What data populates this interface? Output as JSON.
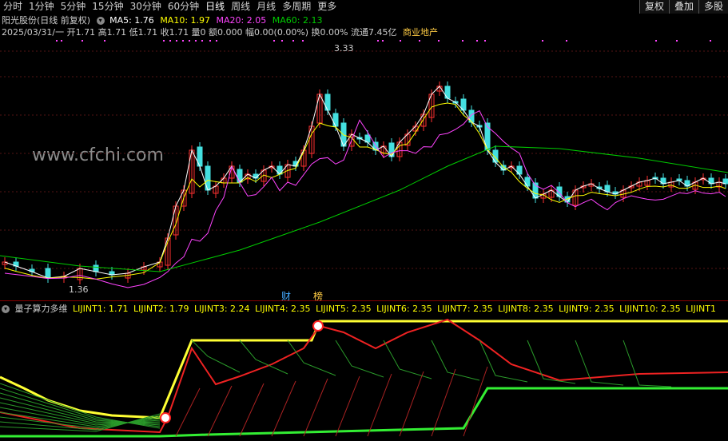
{
  "toolbar": {
    "tabs": [
      "分时",
      "1分钟",
      "5分钟",
      "15分钟",
      "30分钟",
      "60分钟",
      "日线",
      "周线",
      "月线",
      "多周期",
      "更多"
    ],
    "active": "日线",
    "right": [
      "复权",
      "叠加",
      "多股"
    ]
  },
  "header": {
    "title": "阳光股份(日线 前复权)",
    "ma5": "MA5: 1.76",
    "ma10": "MA10: 1.97",
    "ma20": "MA20: 2.05",
    "ma60": "MA60: 2.13",
    "info": "2025/03/31/一 开1.71 高1.71 低1.71 收1.71 量0 额0.000 幅0.00(0.00%) 换0.00% 流通7.45亿",
    "sector": "商业地产"
  },
  "price_labels": {
    "high": "3.33",
    "low": "1.36"
  },
  "tags": {
    "cai": "财",
    "bang": "榜"
  },
  "watermark": "www.cfchi.com",
  "indicator": {
    "title": "量子算力多维",
    "values": [
      "LIJINT1: 1.71",
      "LIJINT2: 1.79",
      "LIJINT3: 2.24",
      "LIJINT4: 2.35",
      "LIJINT5: 2.35",
      "LIJINT6: 2.35",
      "LIJINT7: 2.35",
      "LIJINT8: 2.35",
      "LIJINT9: 2.35",
      "LIJINT10: 2.35",
      "LIJINT1"
    ]
  },
  "colors": {
    "ma5": "#ffffff",
    "ma10": "#ffff00",
    "ma20": "#ff44ff",
    "ma60": "#00cc00",
    "up": "#ff3030",
    "down": "#44e0e0",
    "sector": "#ffcc44"
  }
}
